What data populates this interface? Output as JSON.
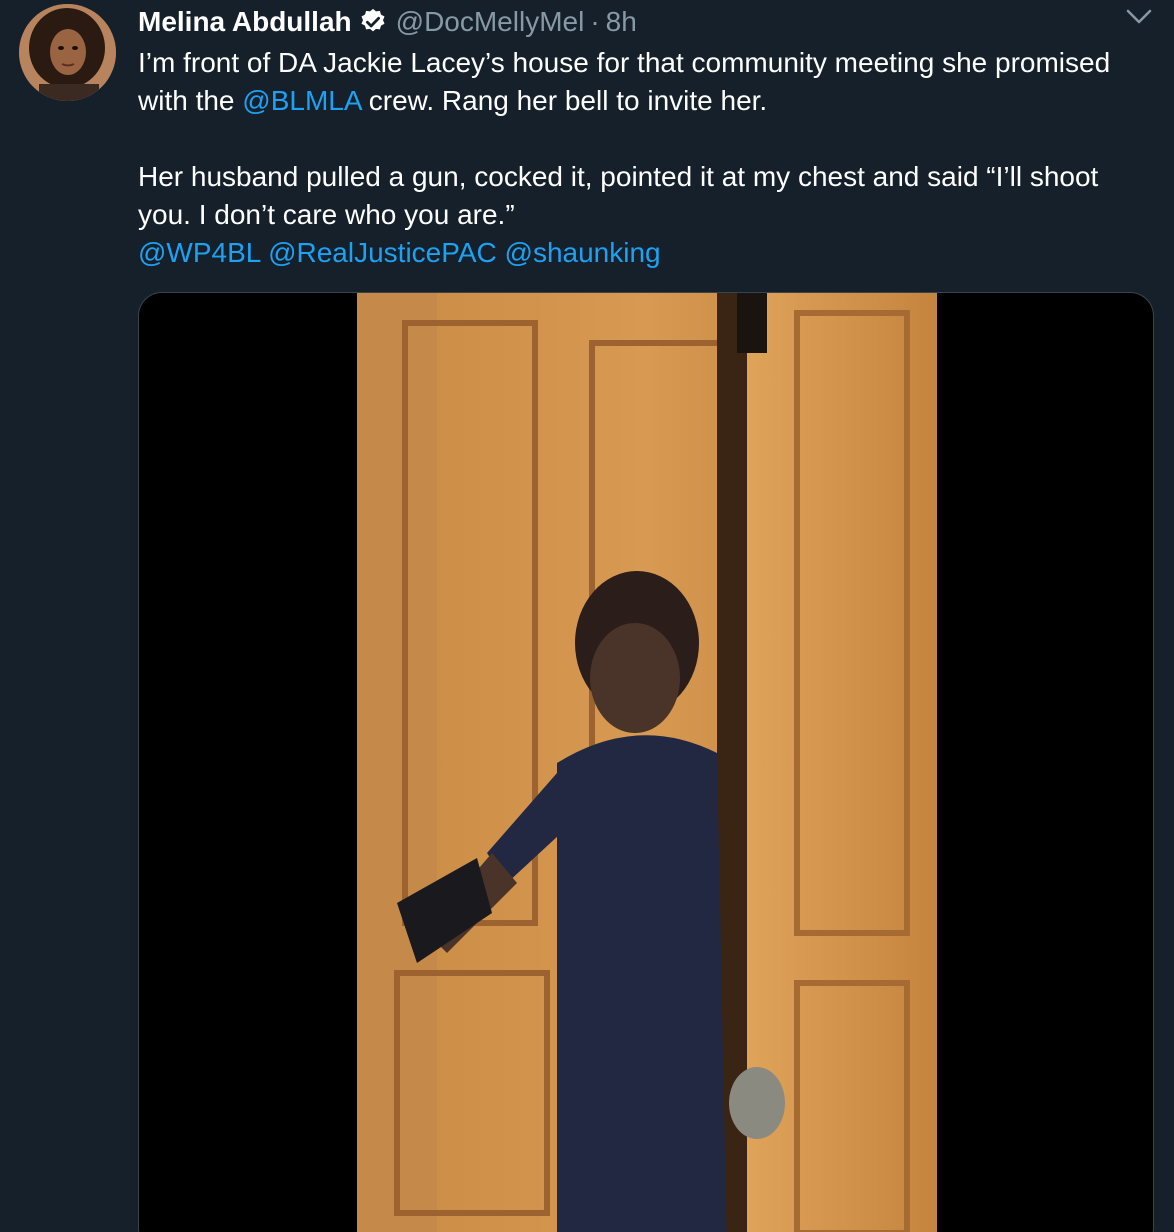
{
  "author": {
    "display_name": "Melina Abdullah",
    "handle": "@DocMellyMel",
    "separator": "·",
    "time": "8h",
    "verified": true
  },
  "tweet": {
    "line1_a": "I’m front of DA Jackie Lacey’s house for that community meeting she promised with the ",
    "line1_mention": "@BLMLA",
    "line1_b": " crew. Rang her bell to invite her.",
    "line2": "Her husband pulled a gun, cocked it, pointed it at my chest and said “I’ll shoot you. I don’t care who you are.”",
    "mentions": [
      "@WP4BL",
      "@RealJusticePAC",
      "@shaunking"
    ]
  },
  "icons": {
    "verified": "verified-badge-icon",
    "menu": "chevron-down-icon"
  },
  "colors": {
    "background": "#15202b",
    "mention": "#1da1f2",
    "secondary_text": "#8899a6"
  }
}
